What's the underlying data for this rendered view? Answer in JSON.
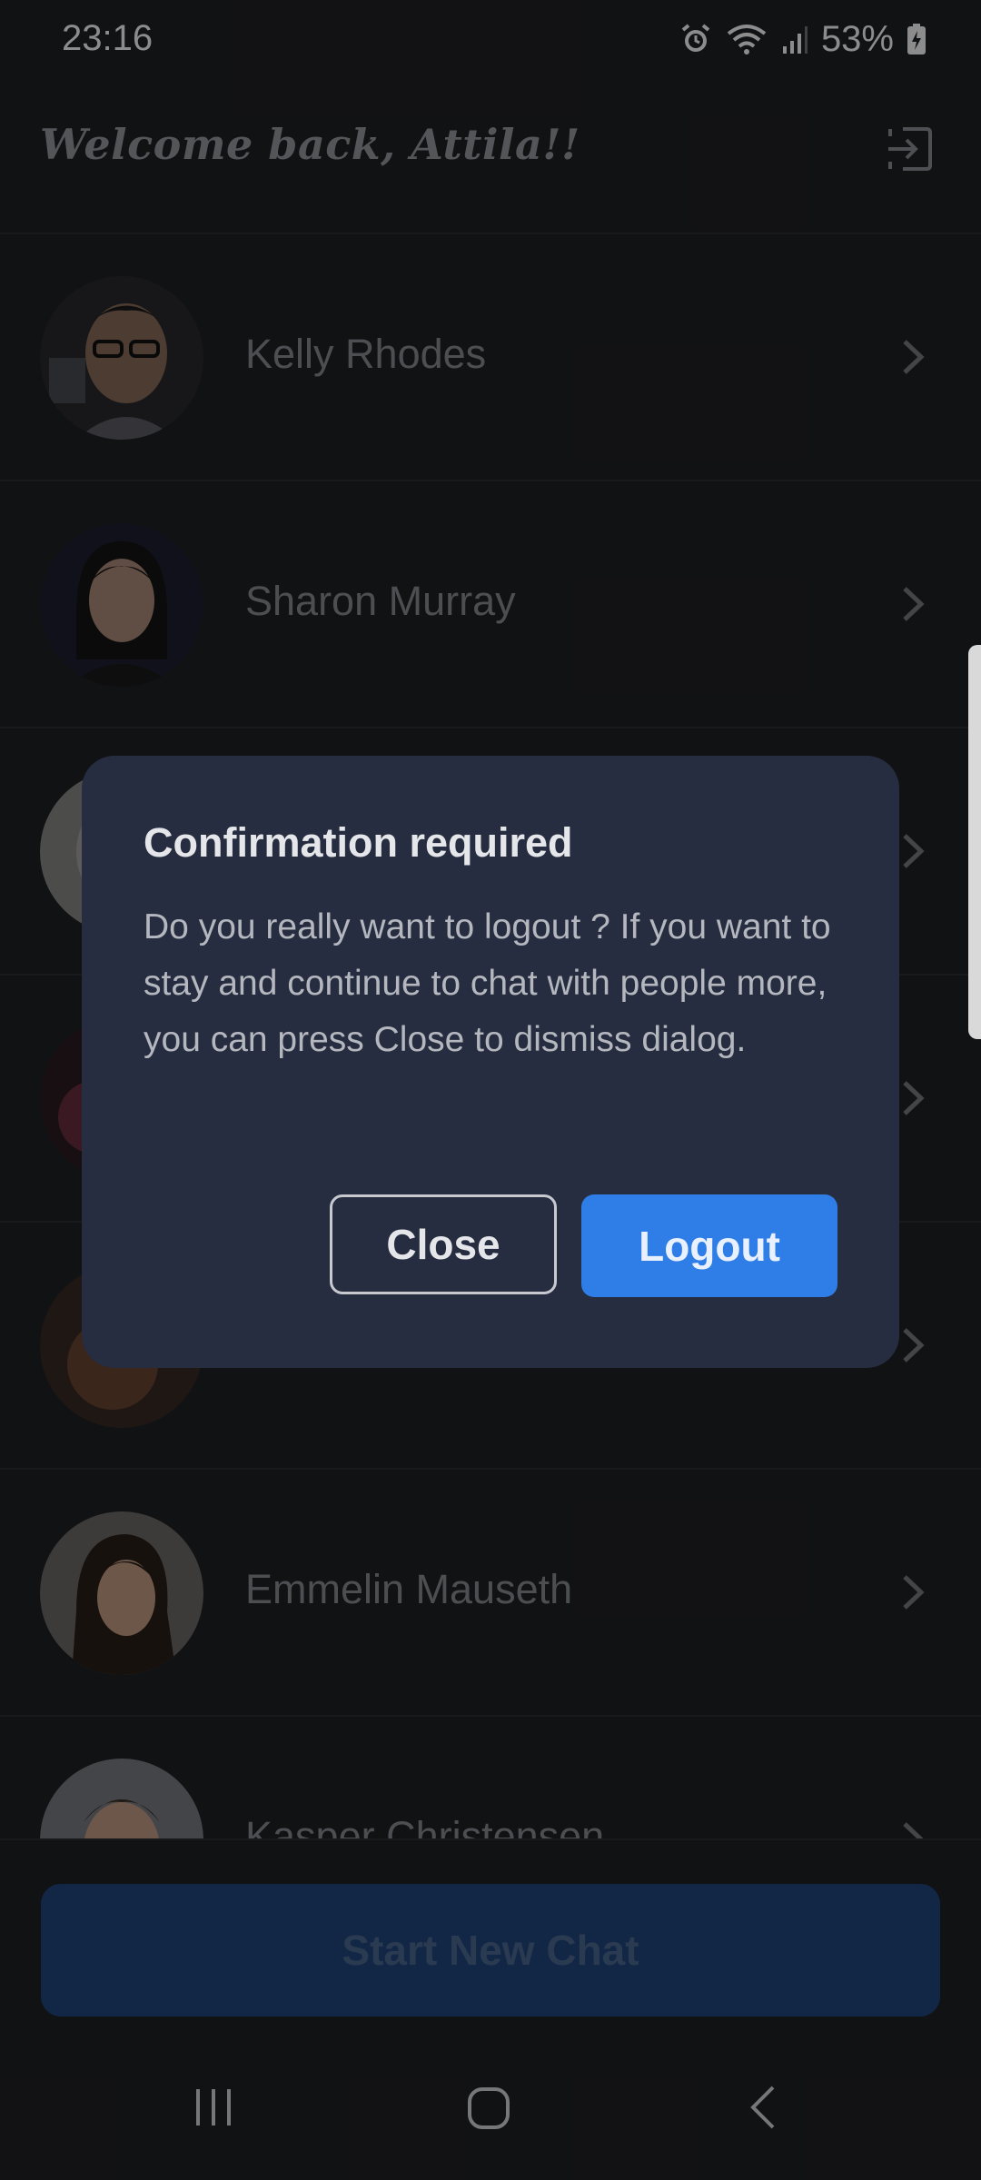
{
  "status_bar": {
    "time": "23:16",
    "battery_percent": "53%",
    "icons": [
      "alarm-icon",
      "wifi-icon",
      "signal-icon",
      "battery-charging-icon"
    ]
  },
  "header": {
    "welcome": "Welcome back, Attila!!",
    "logout_icon": "logout-icon"
  },
  "contacts": [
    {
      "name": "Kelly Rhodes"
    },
    {
      "name": "Sharon Murray"
    },
    {
      "name": ""
    },
    {
      "name": ""
    },
    {
      "name": ""
    },
    {
      "name": "Emmelin Mauseth"
    },
    {
      "name": "Kasper Christensen"
    }
  ],
  "cta": {
    "label": "Start New Chat"
  },
  "dialog": {
    "title": "Confirmation required",
    "message": "Do you really want to logout ? If you want to stay and continue to chat with people more, you can press Close to dismiss dialog.",
    "close_label": "Close",
    "logout_label": "Logout"
  },
  "navbar": {
    "icons": [
      "recent-apps-icon",
      "home-icon",
      "back-icon"
    ]
  },
  "colors": {
    "background": "#202126",
    "dialog": "#272d40",
    "primary": "#2f7de6",
    "cta_dimmed": "#22477f"
  }
}
